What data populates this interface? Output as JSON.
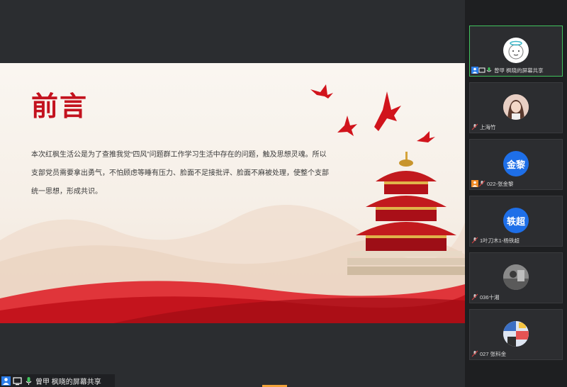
{
  "slide": {
    "title": "前言",
    "body": "本次红枫生活公是为了查推我觉“四风”问题群工作学习生活中存在的问题，触及思想灵魂。所以支部党员需要拿出勇气，不怕顾虑等睡有压力、脸面不足接批评、脸面不麻被处理，使整个支部统一思想，形成共识。"
  },
  "bottom_bar": {
    "label": "曾甲   枫晓的屏幕共享"
  },
  "participants": [
    {
      "name": "曾甲  枫晓的屏幕共享",
      "avatar_type": "doodle",
      "active": true
    },
    {
      "name": "上海竹",
      "avatar_type": "photo-woman"
    },
    {
      "name": "022-张金黎",
      "avatar_type": "text",
      "avatar_text": "金黎"
    },
    {
      "name": "1叶刀木1-杨铁超",
      "avatar_type": "text",
      "avatar_text": "轶超"
    },
    {
      "name": "036十湘",
      "avatar_type": "photo-gray"
    },
    {
      "name": "027 张科金",
      "avatar_type": "photo-collage"
    }
  ],
  "colors": {
    "title_red": "#c3121e",
    "active_border": "#41c35d",
    "avatar_blue": "#1e6fe8",
    "progress_orange": "#f2a23a"
  }
}
